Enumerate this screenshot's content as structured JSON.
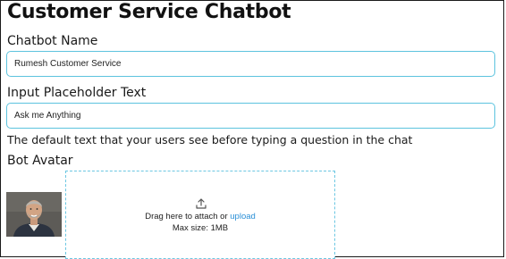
{
  "page_title": "Customer Service Chatbot",
  "chatbot_name": {
    "label": "Chatbot Name",
    "value": "Rumesh Customer Service"
  },
  "input_placeholder": {
    "label": "Input Placeholder Text",
    "value": "Ask me Anything",
    "help_text": "The default text that your users see before typing a question in the chat"
  },
  "bot_avatar": {
    "label": "Bot Avatar",
    "dropzone": {
      "icon": "upload-icon",
      "drag_text": "Drag here to attach or",
      "upload_link": "upload",
      "max_size": "Max size: 1MB"
    }
  },
  "colors": {
    "field_border": "#5cc3de",
    "link": "#2a8fd6"
  }
}
